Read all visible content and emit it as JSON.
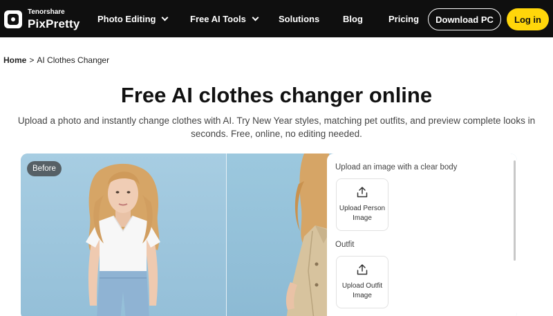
{
  "nav": {
    "logo_top": "Tenorshare",
    "logo_main": "PixPretty",
    "items": [
      {
        "label": "Photo Editing",
        "dropdown": true
      },
      {
        "label": "Free AI Tools",
        "dropdown": true
      },
      {
        "label": "Solutions",
        "dropdown": false
      },
      {
        "label": "Blog",
        "dropdown": false
      },
      {
        "label": "Pricing",
        "dropdown": false
      }
    ],
    "download_label": "Download PC",
    "login_label": "Log in"
  },
  "breadcrumb": {
    "home": "Home",
    "separator": ">",
    "current": "AI Clothes Changer"
  },
  "hero": {
    "title_highlight": "Free",
    "title_rest": " AI clothes changer online",
    "subtitle_line1": "Upload a photo and instantly change clothes with AI. Try New Year styles, matching pet outfits, and preview complete looks in",
    "subtitle_line2": "seconds. Free, online, no editing needed."
  },
  "preview": {
    "before_label": "Before"
  },
  "panel": {
    "person_label": "Upload an image with a clear body",
    "person_button_line1": "Upload Person",
    "person_button_line2": "Image",
    "outfit_label": "Outfit",
    "outfit_button_line1": "Upload Outfit",
    "outfit_button_line2": "Image"
  },
  "colors": {
    "nav_bg": "#0f0f0f",
    "accent_yellow": "#ffd60a",
    "highlight": "#f6e62a",
    "photo_bg": "#9cc6dc"
  },
  "icons": [
    "chevron-down-icon",
    "upload-icon"
  ]
}
